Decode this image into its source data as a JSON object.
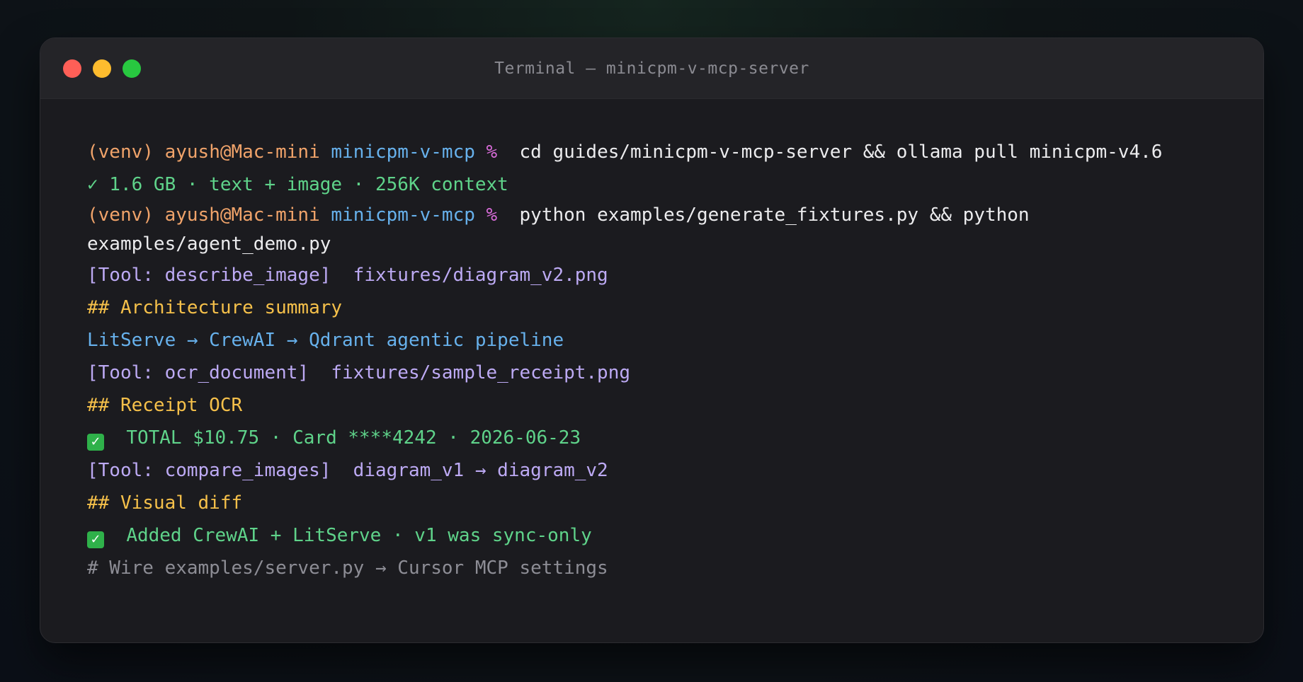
{
  "window": {
    "title": "Terminal — minicpm-v-mcp-server"
  },
  "lines": [
    {
      "venv": "(venv)",
      "user": "ayush@Mac-mini",
      "dir": "minicpm-v-mcp",
      "prompt": "%",
      "cmd": "cd guides/minicpm-v-mcp-server && ollama pull minicpm-v4.6"
    },
    {
      "text": "✓ 1.6 GB · text + image · 256K context"
    },
    {
      "venv": "(venv)",
      "user": "ayush@Mac-mini",
      "dir": "minicpm-v-mcp",
      "prompt": "%",
      "cmd": "python examples/generate_fixtures.py && python"
    },
    {
      "text": "examples/agent_demo.py"
    },
    {
      "text": "[Tool: describe_image]  fixtures/diagram_v2.png"
    },
    {
      "text": "## Architecture summary"
    },
    {
      "text": "LitServe → CrewAI → Qdrant agentic pipeline"
    },
    {
      "text": "[Tool: ocr_document]  fixtures/sample_receipt.png"
    },
    {
      "text": "## Receipt OCR"
    },
    {
      "icon": "✓",
      "text": "TOTAL $10.75 · Card ****4242 · 2026-06-23"
    },
    {
      "text": "[Tool: compare_images]  diagram_v1 → diagram_v2"
    },
    {
      "text": "## Visual diff"
    },
    {
      "icon": "✓",
      "text": "Added CrewAI + LitServe · v1 was sync-only"
    },
    {
      "text": "# Wire examples/server.py → Cursor MCP settings"
    }
  ],
  "colors": {
    "red": "#ff5f57",
    "yellow": "#febc2e",
    "green": "#28c840",
    "prompt_orange": "#f0a36a",
    "dir_blue": "#67b1ec",
    "prompt_magenta": "#d86cd9",
    "success_green": "#5fd38a",
    "tool_purple": "#bdaaf4",
    "heading_yellow": "#f5c04a",
    "comment_grey": "#8d8d95"
  }
}
